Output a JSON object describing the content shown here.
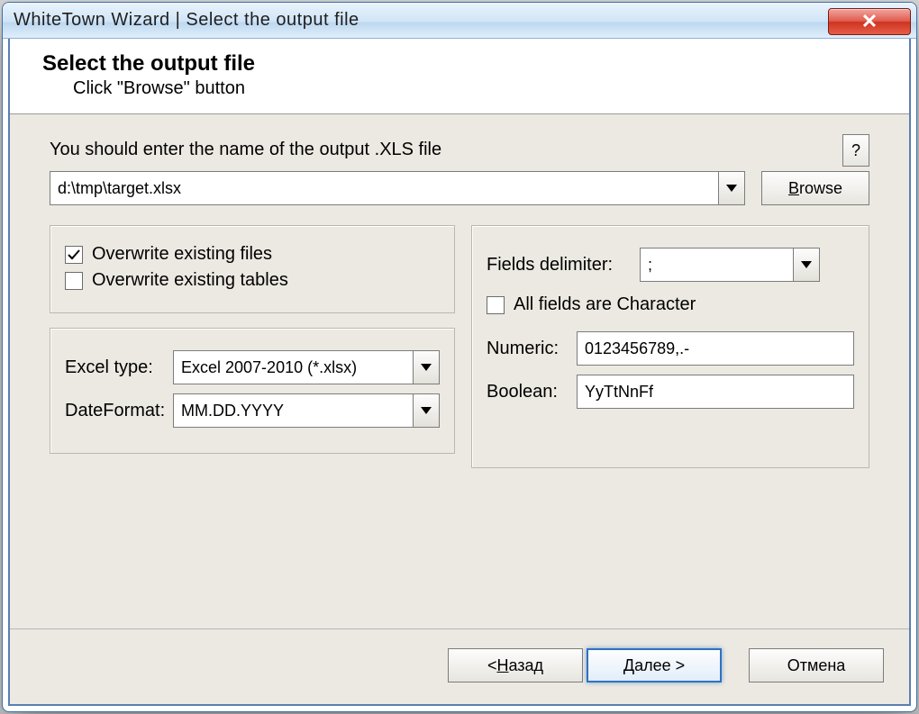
{
  "titlebar": {
    "title": "WhiteTown Wizard | Select the output file"
  },
  "header": {
    "heading": "Select the output file",
    "subtitle": "Click \"Browse\" button"
  },
  "prompt": "You should enter the name of the output .XLS file",
  "help_label": "?",
  "path_value": "d:\\tmp\\target.xlsx",
  "browse_prefix": "B",
  "browse_rest": "rowse",
  "overwrite_files": {
    "label": "Overwrite existing files",
    "checked": true
  },
  "overwrite_tables": {
    "label": "Overwrite existing tables",
    "checked": false
  },
  "excel_type": {
    "label": "Excel type:",
    "value": "Excel 2007-2010 (*.xlsx)"
  },
  "date_fmt": {
    "label": "DateFormat:",
    "value": "MM.DD.YYYY"
  },
  "delim": {
    "label": "Fields delimiter:",
    "value": ";"
  },
  "allchar": {
    "label": "All fields are Character",
    "checked": false
  },
  "numeric": {
    "label": "Numeric:",
    "value": "0123456789,.-"
  },
  "boolean": {
    "label": "Boolean:",
    "value": "YyTtNnFf"
  },
  "footer": {
    "back_prefix": "< ",
    "back_mn": "Н",
    "back_rest": "азад",
    "next_mn": "Д",
    "next_rest": "алее >",
    "cancel": "Отмена"
  }
}
